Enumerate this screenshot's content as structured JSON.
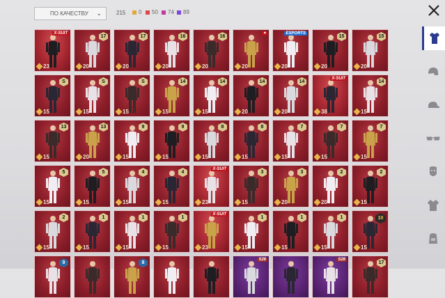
{
  "filter": {
    "sort_label": "ПО КАЧЕСТВУ"
  },
  "stats": {
    "total": "215",
    "rarities": [
      {
        "value": "0",
        "color": "#e0a93a"
      },
      {
        "value": "50",
        "color": "#e04848"
      },
      {
        "value": "74",
        "color": "#c03aa0"
      },
      {
        "value": "89",
        "color": "#7b48d8"
      }
    ]
  },
  "categories": [
    {
      "icon": "outfit-icon",
      "active": true
    },
    {
      "icon": "helmet-icon",
      "active": false
    },
    {
      "icon": "cap-icon",
      "active": false
    },
    {
      "icon": "glasses-icon",
      "active": false
    },
    {
      "icon": "mask-icon",
      "active": false
    },
    {
      "icon": "jacket-icon",
      "active": false
    },
    {
      "icon": "backpack-icon",
      "active": false
    }
  ],
  "cards": [
    {
      "points": "23",
      "tag": "X-SUIT",
      "variant": "xsuit"
    },
    {
      "points": "20",
      "badge": "17"
    },
    {
      "points": "20",
      "badge": "17"
    },
    {
      "points": "20",
      "badge": "16"
    },
    {
      "points": "20",
      "badge": "16"
    },
    {
      "points": "20",
      "tag": "♥"
    },
    {
      "points": "20",
      "tag": "ESPORTS",
      "tagcolor": "blue"
    },
    {
      "points": "20",
      "badge": "15"
    },
    {
      "points": "20",
      "badge": "15"
    },
    {
      "points": "15",
      "badge": "S"
    },
    {
      "points": "15",
      "badge": "S"
    },
    {
      "points": "15",
      "badge": "S"
    },
    {
      "points": "15",
      "badge": "14"
    },
    {
      "points": "15",
      "badge": "14"
    },
    {
      "points": "20",
      "badge": "14"
    },
    {
      "points": "20",
      "badge": "14"
    },
    {
      "points": "38",
      "tag": "X-SUIT",
      "variant": "xsuit"
    },
    {
      "points": "15",
      "badge": "14"
    },
    {
      "points": "15",
      "badge": "13"
    },
    {
      "points": "20",
      "badge": "13"
    },
    {
      "points": "15",
      "badge": "9"
    },
    {
      "points": "15",
      "badge": "9"
    },
    {
      "points": "15",
      "badge": "8"
    },
    {
      "points": "15",
      "badge": "8"
    },
    {
      "points": "15",
      "badge": "7"
    },
    {
      "points": "15",
      "badge": "7"
    },
    {
      "points": "15",
      "badge": "7"
    },
    {
      "points": "15",
      "badge": "5"
    },
    {
      "points": "15",
      "badge": "5"
    },
    {
      "points": "15",
      "badge": "4"
    },
    {
      "points": "15",
      "badge": "4"
    },
    {
      "points": "23",
      "tag": "X-SUIT",
      "variant": "xsuit"
    },
    {
      "points": "15",
      "badge": "3"
    },
    {
      "points": "20",
      "badge": "3"
    },
    {
      "points": "20",
      "badge": "2"
    },
    {
      "points": "15",
      "badge": "2"
    },
    {
      "points": "15",
      "badge": "2"
    },
    {
      "points": "15",
      "badge": "1"
    },
    {
      "points": "15",
      "badge": "1"
    },
    {
      "points": "15",
      "badge": "1"
    },
    {
      "points": "23",
      "tag": "X-SUIT",
      "variant": "xsuit"
    },
    {
      "points": "15",
      "badge": "1"
    },
    {
      "points": "15",
      "badge": "1"
    },
    {
      "points": "15",
      "badge": "1"
    },
    {
      "points": "15",
      "badge": "10",
      "big": true
    },
    {
      "points": "",
      "badge": "9",
      "blue": true
    },
    {
      "points": "",
      "badge": ""
    },
    {
      "points": "",
      "badge": "8",
      "blue": true
    },
    {
      "points": "",
      "badge": ""
    },
    {
      "points": "",
      "badge": ""
    },
    {
      "points": "",
      "tag": "S28",
      "variant": "purple",
      "tagcolor": "purple"
    },
    {
      "points": "",
      "tag": "",
      "variant": "purple"
    },
    {
      "points": "",
      "tag": "S28",
      "variant": "purple",
      "tagcolor": "purple"
    },
    {
      "points": "",
      "badge": "17"
    }
  ]
}
